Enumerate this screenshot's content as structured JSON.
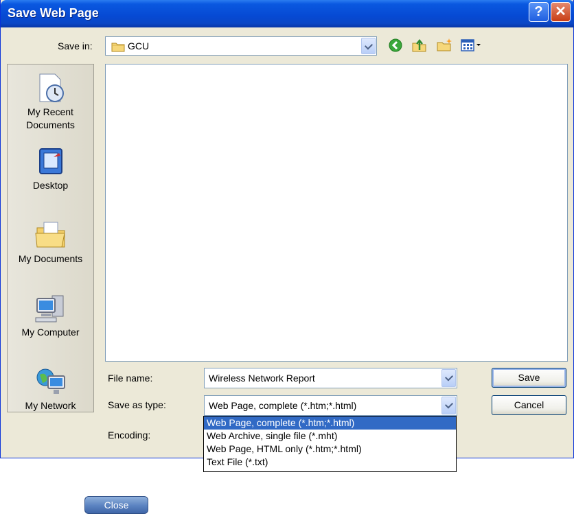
{
  "title": "Save Web Page",
  "title_buttons": {
    "help": "?",
    "close": "✕"
  },
  "save_in": {
    "label": "Save in:",
    "value": "GCU"
  },
  "places": [
    {
      "label": "My Recent Documents",
      "icon": "recent-documents-icon"
    },
    {
      "label": "Desktop",
      "icon": "desktop-icon"
    },
    {
      "label": "My Documents",
      "icon": "my-documents-icon"
    },
    {
      "label": "My Computer",
      "icon": "my-computer-icon"
    },
    {
      "label": "My Network",
      "icon": "my-network-icon"
    }
  ],
  "file_name": {
    "label": "File name:",
    "value": "Wireless Network Report"
  },
  "save_as_type": {
    "label": "Save as type:",
    "value": "Web Page, complete (*.htm;*.html)",
    "options": [
      "Web Page, complete (*.htm;*.html)",
      "Web Archive, single file (*.mht)",
      "Web Page, HTML only (*.htm;*.html)",
      "Text File (*.txt)"
    ]
  },
  "encoding": {
    "label": "Encoding:"
  },
  "buttons": {
    "save": "Save",
    "cancel": "Cancel"
  },
  "close_button": "Close"
}
